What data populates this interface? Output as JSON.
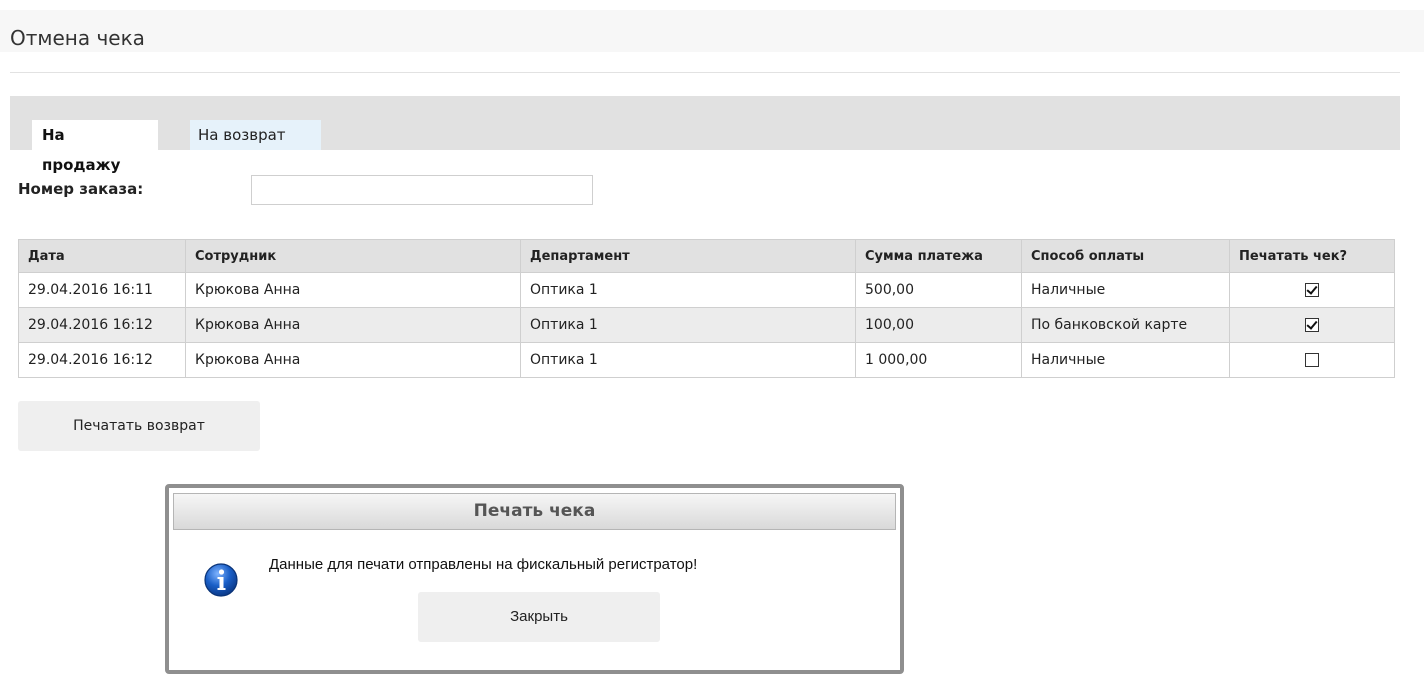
{
  "page": {
    "title": "Отмена чека"
  },
  "tabs": [
    {
      "label": "На продажу",
      "active": true
    },
    {
      "label": "На возврат",
      "active": false
    }
  ],
  "order": {
    "label": "Номер заказа:",
    "value": ""
  },
  "table": {
    "columns": [
      "Дата",
      "Сотрудник",
      "Департамент",
      "Сумма платежа",
      "Способ оплаты",
      "Печатать чек?"
    ],
    "rows": [
      {
        "date": "29.04.2016 16:11",
        "employee": "Крюкова Анна",
        "department": "Оптика 1",
        "amount": "500,00",
        "payment": "Наличные",
        "print": true
      },
      {
        "date": "29.04.2016 16:12",
        "employee": "Крюкова Анна",
        "department": "Оптика 1",
        "amount": "100,00",
        "payment": "По банковской карте",
        "print": true
      },
      {
        "date": "29.04.2016 16:12",
        "employee": "Крюкова Анна",
        "department": "Оптика 1",
        "amount": "1 000,00",
        "payment": "Наличные",
        "print": false
      }
    ]
  },
  "actions": {
    "print_return_label": "Печатать возврат"
  },
  "dialog": {
    "title": "Печать чека",
    "message": "Данные для печати отправлены на фискальный регистратор!",
    "close_label": "Закрыть",
    "icon": "info-icon"
  },
  "colors": {
    "header_bg": "#e1e1e1",
    "row_alt_bg": "#ececec",
    "info_icon_blue": "#1a5fc7",
    "dialog_border": "#8f8f8f"
  }
}
